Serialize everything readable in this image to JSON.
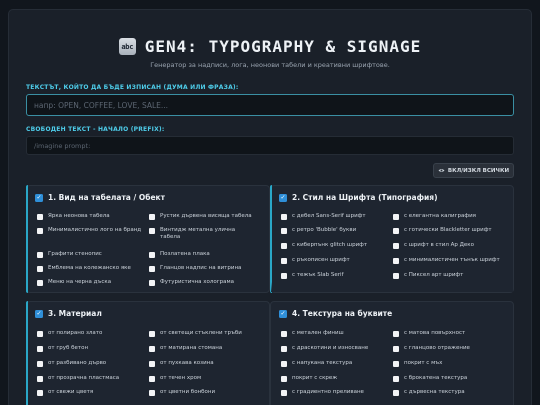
{
  "header": {
    "icon_text": "abc",
    "title": "GEN4: TYPOGRAPHY & SIGNAGE",
    "subtitle": "Генератор за надписи, лога, неонови табели и креативни шрифтове."
  },
  "text_field": {
    "label": "ТЕКСТЪТ, КОЙТО ДА БЪДЕ ИЗПИСАН (ДУМА ИЛИ ФРАЗА):",
    "placeholder": "напр: OPEN, COFFEE, LOVE, SALE..."
  },
  "prefix_field": {
    "label": "СВОБОДЕН ТЕКСТ - НАЧАЛО (PREFIX):",
    "placeholder": "/imagine prompt:"
  },
  "toggle_all_button": {
    "label": "ВКЛ/ИЗКЛ ВСИЧКИ",
    "icon": "eye-icon"
  },
  "panels": [
    {
      "title": "1. Вид на табелата / Обект",
      "checked": true,
      "options_left": [
        "Ярка неонова табела",
        "Минималистично лого на бранд",
        "Графити стенопис",
        "Емблема на колежанско яке",
        "Меню на черна дъска"
      ],
      "options_right": [
        "Рустик дървена висяща табела",
        "Винтидж метална улична табела",
        "Позлатена плака",
        "Гланцов надпис на витрина",
        "Футуристична холограма"
      ]
    },
    {
      "title": "2. Стил на Шрифта (Типография)",
      "checked": true,
      "options_left": [
        "с дебел Sans-Serif шрифт",
        "с ретро 'Bubble' букви",
        "с киберпънк glitch шрифт",
        "с ръкописен шрифт",
        "с тежък Slab Serif"
      ],
      "options_right": [
        "с елегантна калиграфия",
        "с готически Blackletter шрифт",
        "с шрифт в стил Ар Деко",
        "с минималистичен тънък шрифт",
        "с Пиксел арт шрифт"
      ]
    },
    {
      "title": "3. Материал",
      "checked": true,
      "options_left": [
        "от полирано злато",
        "от груб бетон",
        "от разбивано дърво",
        "от прозрачна пластмаса",
        "от свежи цветя"
      ],
      "options_right": [
        "от светещи стъклени тръби",
        "от матирана стомана",
        "от пухкава козина",
        "от течен хром",
        "от цветни бонбони"
      ]
    },
    {
      "title": "4. Текстура на буквите",
      "checked": true,
      "options_left": [
        "с метален финиш",
        "с драскотини и износване",
        "с напукана текстура",
        "покрит с скреж",
        "с градиентно преливане"
      ],
      "options_right": [
        "с матова повърхност",
        "с гланцово отражение",
        "покрит с мъх",
        "с брокатена текстура",
        "с дървесна текстура"
      ]
    }
  ],
  "colors": {
    "accent": "#4ecdea",
    "checkbox": "#2f8fd8",
    "background": "#11161d",
    "panel": "#1e2530"
  }
}
